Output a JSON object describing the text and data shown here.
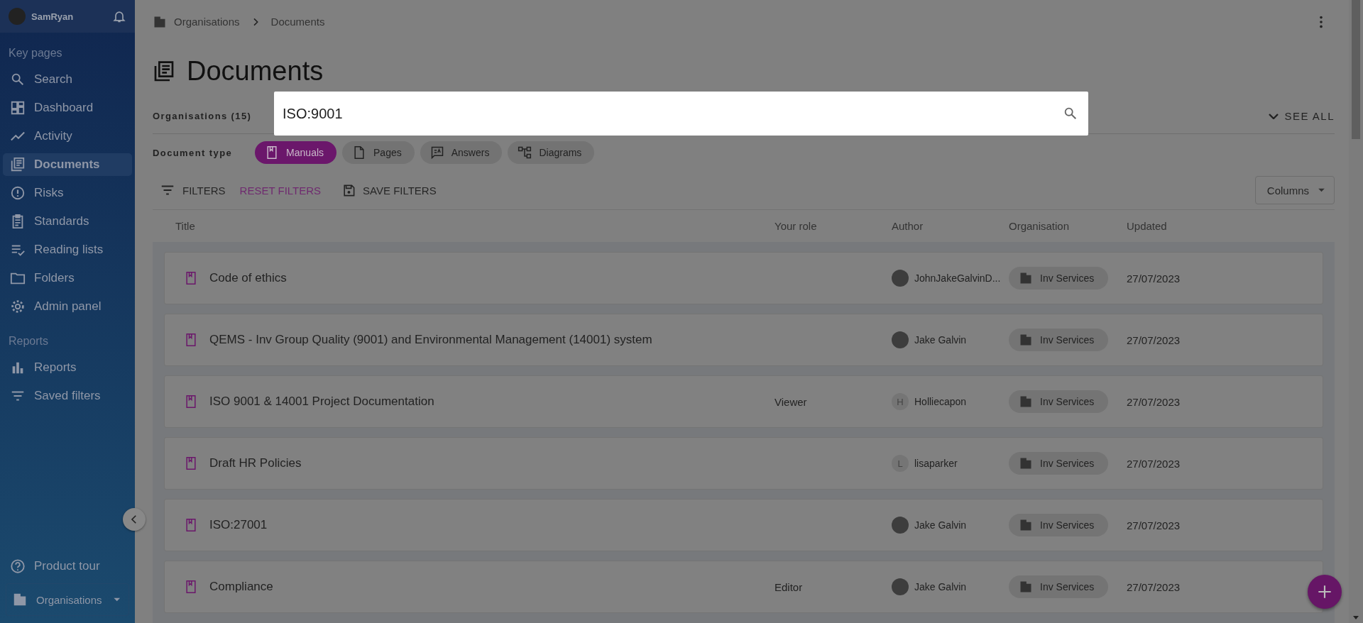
{
  "sidebar": {
    "user": {
      "name": "SamRyan"
    },
    "sections": [
      {
        "heading": "Key pages",
        "items": [
          {
            "label": "Search",
            "kind": "search",
            "selected": false
          },
          {
            "label": "Dashboard",
            "kind": "dashboard",
            "selected": false
          },
          {
            "label": "Activity",
            "kind": "activity",
            "selected": false
          },
          {
            "label": "Documents",
            "kind": "documents",
            "selected": true
          },
          {
            "label": "Risks",
            "kind": "risks",
            "selected": false
          },
          {
            "label": "Standards",
            "kind": "standards",
            "selected": false
          },
          {
            "label": "Reading lists",
            "kind": "reading",
            "selected": false
          },
          {
            "label": "Folders",
            "kind": "folders",
            "selected": false
          },
          {
            "label": "Admin panel",
            "kind": "admin",
            "selected": false
          }
        ]
      },
      {
        "heading": "Reports",
        "items": [
          {
            "label": "Reports",
            "kind": "reports",
            "selected": false
          },
          {
            "label": "Saved filters",
            "kind": "filters",
            "selected": false
          }
        ]
      }
    ],
    "product_tour": "Product tour",
    "org_switcher": "Organisations"
  },
  "breadcrumb": [
    "Organisations",
    "Documents"
  ],
  "page_title": "Documents",
  "organisations_filter": {
    "label": "Organisations (15)",
    "see_all": "SEE ALL"
  },
  "search": {
    "value": "ISO:9001"
  },
  "document_types": {
    "label": "Document type",
    "items": [
      {
        "label": "Manuals",
        "kind": "manual",
        "selected": true
      },
      {
        "label": "Pages",
        "kind": "page",
        "selected": false
      },
      {
        "label": "Answers",
        "kind": "answer",
        "selected": false
      },
      {
        "label": "Diagrams",
        "kind": "diagram",
        "selected": false
      }
    ]
  },
  "toolbar": {
    "filters": "FILTERS",
    "reset": "RESET FILTERS",
    "save": "SAVE FILTERS",
    "columns": "Columns"
  },
  "table": {
    "columns": [
      "Title",
      "Your role",
      "Author",
      "Organisation",
      "Updated"
    ],
    "rows": [
      {
        "title": "Code of ethics",
        "role": "",
        "author": {
          "name": "JohnJakeGalvinD..."
        },
        "organisation": "Inv Services",
        "updated": "27/07/2023"
      },
      {
        "title": "QEMS - Inv Group Quality (9001) and Environmental Management (14001) system",
        "role": "",
        "author": {
          "name": "Jake Galvin"
        },
        "organisation": "Inv Services",
        "updated": "27/07/2023"
      },
      {
        "title": "ISO 9001 & 14001 Project Documentation",
        "role": "Viewer",
        "author": {
          "name": "Holliecapon",
          "initial": "H"
        },
        "organisation": "Inv Services",
        "updated": "27/07/2023"
      },
      {
        "title": "Draft HR Policies",
        "role": "",
        "author": {
          "name": "lisaparker",
          "initial": "L"
        },
        "organisation": "Inv Services",
        "updated": "27/07/2023"
      },
      {
        "title": "ISO:27001",
        "role": "",
        "author": {
          "name": "Jake Galvin"
        },
        "organisation": "Inv Services",
        "updated": "27/07/2023"
      },
      {
        "title": "Compliance",
        "role": "Editor",
        "author": {
          "name": "Jake Galvin"
        },
        "organisation": "Inv Services",
        "updated": "27/07/2023"
      }
    ]
  }
}
